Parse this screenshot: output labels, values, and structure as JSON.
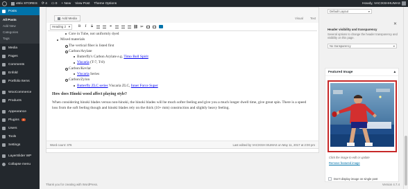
{
  "adminbar": {
    "site_name": "vMix STORES",
    "updates": "4",
    "comments": "0",
    "new_label": "+ New",
    "view_post": "View Post",
    "theme_options": "Theme Options",
    "howdy": "Howdy, VACIXSHHUMAS"
  },
  "sidebar": {
    "posts": "Posts",
    "sub_all_posts": "All Posts",
    "sub_add_new": "Add New",
    "sub_categories": "Categories",
    "sub_tags": "Tags",
    "items": [
      {
        "label": "Media",
        "icon": "media-icon"
      },
      {
        "label": "Pages",
        "icon": "pages-icon"
      },
      {
        "label": "Comments",
        "icon": "comments-icon"
      },
      {
        "label": "Enfold",
        "icon": "enfold-icon"
      },
      {
        "label": "Portfolio Items",
        "icon": "portfolio-icon"
      },
      {
        "label": "WooCommerce",
        "icon": "woocommerce-icon"
      },
      {
        "label": "Products",
        "icon": "products-icon"
      },
      {
        "label": "Appearance",
        "icon": "appearance-icon"
      },
      {
        "label": "Plugins",
        "icon": "plugins-icon",
        "badge": "4"
      },
      {
        "label": "Users",
        "icon": "users-icon"
      },
      {
        "label": "Tools",
        "icon": "tools-icon"
      },
      {
        "label": "Settings",
        "icon": "settings-icon"
      },
      {
        "label": "LayerSlider WP",
        "icon": "layerslider-icon"
      },
      {
        "label": "Collapse menu",
        "icon": "collapse-icon"
      }
    ]
  },
  "editor": {
    "add_media": "Add Media",
    "tab_visual": "Visual",
    "tab_text": "Text",
    "format_select": "Heading 2",
    "lines": {
      "l1": "Core in Tube, not uniformly dyed",
      "l2": "Mixed materials",
      "l3": "The vertical fiber is listed first",
      "l4": "Carbon/Arylate",
      "l5_a": "Butterfly's Carbon Arylate e.g.",
      "l5_link": "Timo Boll Spirit",
      "l6_link": "Viscaria",
      "l6_b": "(T-7, T-8)",
      "l7": "Carbon/Kevlar",
      "l8_link": "Viscaria",
      "l8_b": "Series",
      "l9": "Carbon/Zylon",
      "l10_link": "Butterfly ZLC series",
      "l10_b": "Viscaria ZLC,",
      "l10_link2": "Inner Force Super"
    },
    "heading": "How does Hinoki wood affect playing style?",
    "paragraph": "When considering hinoki blades versus non-hinoki, the hinoki blades will be much softer feeling and give you a much longer dwell time, give great spin. There is a speed loss from the soft feeling though and hinoki blades rely on the thick (10+ mm) construction and slightly heavy feeling.",
    "word_count": "Word count: 376",
    "last_edited": "Last edited by VACIXSH ISUMAS on May 11, 2017 at 2:00 pm"
  },
  "rightcol": {
    "select_default": "Default Layout",
    "header_vis_label": "Header visibility and transparency",
    "header_vis_desc": "Several options to change the header transparency and visibility on this page.",
    "select_transparency": "No transparency",
    "featured_title": "Featured Image",
    "caption": "Click the image to edit or update",
    "remove": "Remove featured image",
    "dont_display": "Don't display image on single post"
  },
  "footer": {
    "thanks": "Thank you for creating with WordPress.",
    "version": "Version 4.7.4"
  },
  "colors": {
    "admin_bg": "#23282d",
    "accent": "#0073aa",
    "highlight_border": "#c62828"
  }
}
